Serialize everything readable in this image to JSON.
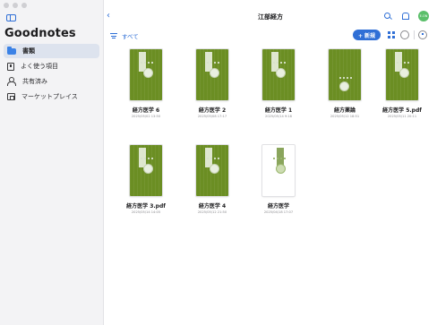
{
  "app": {
    "title": "Goodnotes"
  },
  "sidebar": {
    "items": [
      {
        "label": "書類",
        "icon": "folder-icon",
        "active": true
      },
      {
        "label": "よく使う項目",
        "icon": "bookmark-icon",
        "active": false
      },
      {
        "label": "共有済み",
        "icon": "people-icon",
        "active": false
      },
      {
        "label": "マーケットプレイス",
        "icon": "store-icon",
        "active": false
      }
    ]
  },
  "header": {
    "title": "江部経方",
    "back_icon": "chevron-left-icon",
    "avatar_text": "E.ON"
  },
  "toolbar": {
    "sort_label": "すべて",
    "new_label": "+ 新規"
  },
  "notebooks": [
    {
      "title": "経方医学 6",
      "date": "2025/05/02 13:50",
      "cover": "dark"
    },
    {
      "title": "経方医学 2",
      "date": "2025/05/08 17:17",
      "cover": "dark"
    },
    {
      "title": "経方医学 1",
      "date": "2025/05/14 9:18",
      "cover": "dark"
    },
    {
      "title": "経方薬論",
      "date": "2025/05/12 18:51",
      "cover": "dark"
    },
    {
      "title": "経方医学 5.pdf",
      "date": "2025/05/11 20:11",
      "cover": "dark"
    },
    {
      "title": "経方医学 3.pdf",
      "date": "2025/05/14 14:05",
      "cover": "dark"
    },
    {
      "title": "経方医学 4",
      "date": "2025/05/12 21:50",
      "cover": "dark"
    },
    {
      "title": "経方医学",
      "date": "2025/04/18 17:07",
      "cover": "light"
    }
  ],
  "colors": {
    "accent": "#2f6fd6",
    "cover_green": "#6b8e23",
    "sidebar_bg": "#f3f3f5",
    "avatar": "#5bbf6a"
  }
}
